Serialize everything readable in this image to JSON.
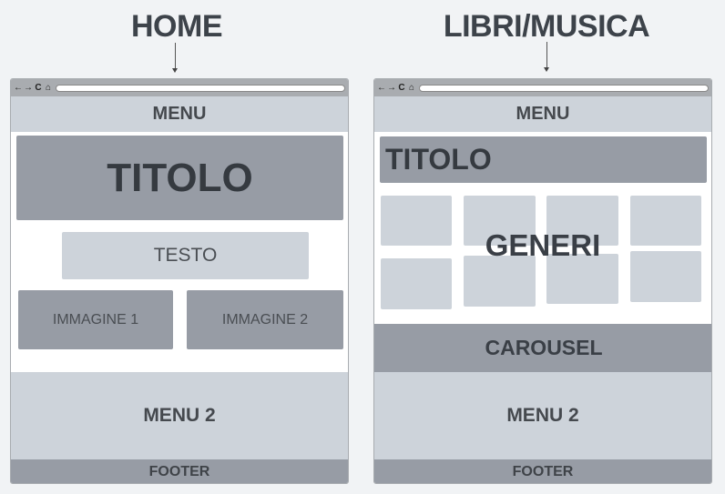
{
  "pages": [
    {
      "heading": "HOME",
      "browser": {
        "toolbar_icons": [
          "back-arrow-icon",
          "forward-arrow-icon",
          "reload-icon",
          "home-icon"
        ],
        "menu": "MENU",
        "title": "TITOLO",
        "text": "TESTO",
        "images": [
          "IMMAGINE 1",
          "IMMAGINE 2"
        ],
        "menu2": "MENU 2",
        "footer": "FOOTER"
      }
    },
    {
      "heading": "LIBRI/MUSICA",
      "browser": {
        "toolbar_icons": [
          "back-arrow-icon",
          "forward-arrow-icon",
          "reload-icon",
          "home-icon"
        ],
        "menu": "MENU",
        "title": "TITOLO",
        "genres_label": "GENERI",
        "genre_tile_count": 8,
        "carousel": "CAROUSEL",
        "menu2": "MENU 2",
        "footer": "FOOTER"
      }
    }
  ],
  "icons": {
    "back": "←",
    "forward": "→",
    "reload": "C",
    "home": "⌂"
  },
  "colors": {
    "background": "#f1f3f5",
    "dark_block": "#979ca5",
    "light_block": "#cdd3da",
    "text": "#3d434a"
  }
}
